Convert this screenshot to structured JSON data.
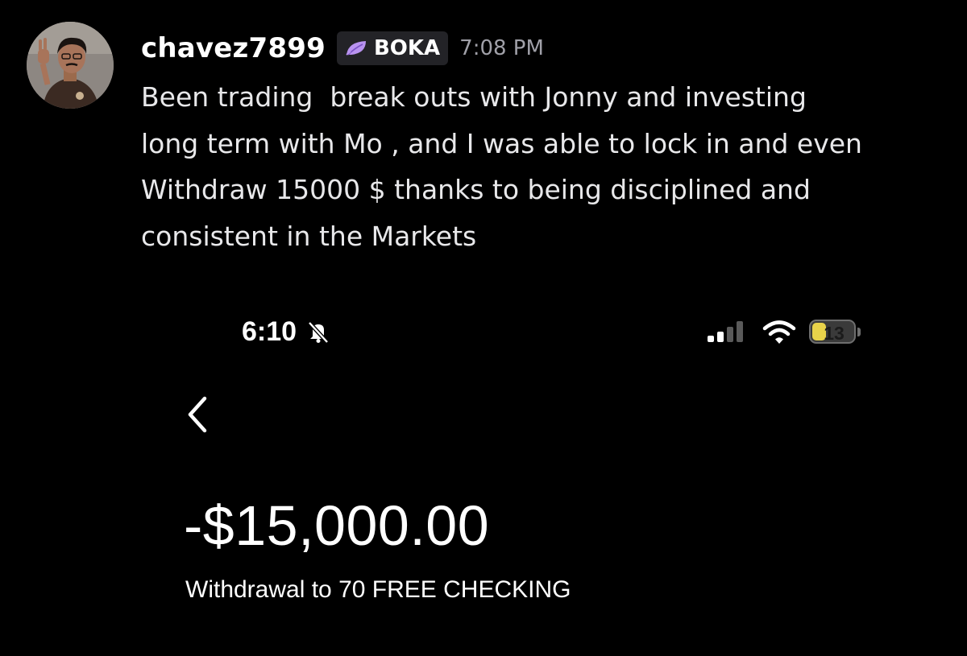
{
  "message": {
    "username": "chavez7899",
    "role_tag": {
      "icon": "leaf-icon",
      "icon_color": "#b993f0",
      "label": "BOKA"
    },
    "timestamp": "7:08 PM",
    "text": "Been trading  break outs with Jonny and investing\nlong term with Mo , and I was able to lock in and even\nWithdraw 15000 $ thanks to being disciplined and\nconsistent in the Markets"
  },
  "attachment": {
    "status_bar": {
      "time": "6:10",
      "silent_icon": "bell-slash-icon",
      "signal_icon": "cellular-signal-icon",
      "wifi_icon": "wifi-icon",
      "battery_level": "13",
      "battery_fraction": 0.13
    },
    "back_icon": "chevron-left-icon",
    "amount": "-$15,000.00",
    "description": "Withdrawal to 70 FREE CHECKING"
  },
  "colors": {
    "background": "#000000",
    "text_primary": "#ffffff",
    "text_secondary": "#a0a0a8",
    "role_tag_bg": "#232327",
    "battery_yellow": "#e8d24a"
  }
}
